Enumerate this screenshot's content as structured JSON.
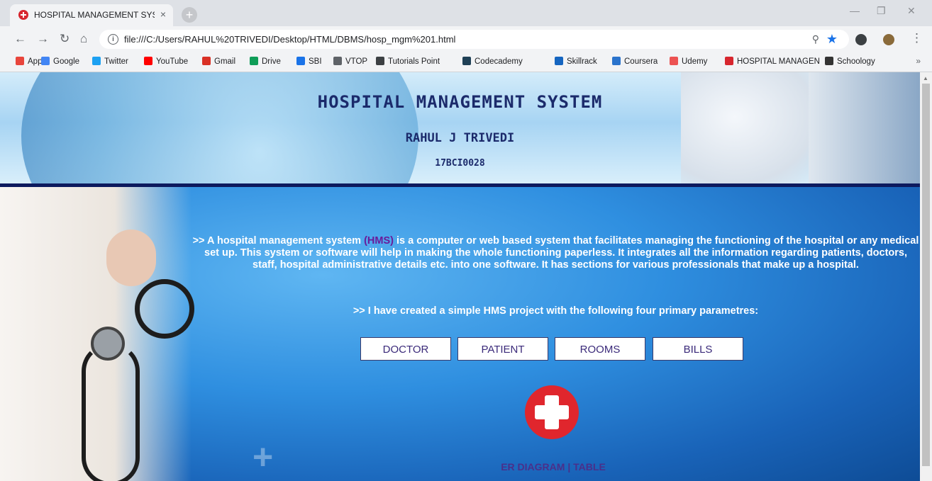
{
  "browser": {
    "tab_title": "HOSPITAL MANAGEMENT SYSTE",
    "tab_close": "×",
    "new_tab": "+",
    "url": "file:///C:/Users/RAHUL%20TRIVEDI/Desktop/HTML/DBMS/hosp_mgm%201.html",
    "bookmarks": [
      {
        "label": "Apps",
        "color": "#e8453c"
      },
      {
        "label": "Google",
        "color": "#4285f4"
      },
      {
        "label": "Twitter",
        "color": "#1da1f2"
      },
      {
        "label": "YouTube",
        "color": "#ff0000"
      },
      {
        "label": "Gmail",
        "color": "#d93025"
      },
      {
        "label": "Drive",
        "color": "#0f9d58"
      },
      {
        "label": "SBI",
        "color": "#1a73e8"
      },
      {
        "label": "VTOP",
        "color": "#5f6368"
      },
      {
        "label": "Tutorials Point",
        "color": "#3c4043"
      },
      {
        "label": "Codecademy",
        "color": "#1f4056"
      },
      {
        "label": "Skillrack",
        "color": "#1565c0"
      },
      {
        "label": "Coursera",
        "color": "#2a73cc"
      },
      {
        "label": "Udemy",
        "color": "#ec5252"
      },
      {
        "label": "HOSPITAL MANAGEN",
        "color": "#d7262e"
      },
      {
        "label": "Schoology",
        "color": "#333333"
      }
    ],
    "bookmarks_more": "»"
  },
  "header": {
    "title": "HOSPITAL MANAGEMENT SYSTEM",
    "name": "RAHUL J TRIVEDI",
    "id": "17BCI0028"
  },
  "intro": {
    "prefix": ">> A hospital management system ",
    "hms": "(HMS)",
    "body": " is a computer or web based system that facilitates managing the functioning of the hospital or any medical set up. This system or software will help in making the whole functioning paperless. It integrates all the information regarding patients, doctors, staff, hospital administrative details etc. into one software. It has sections for various professionals that make up a hospital.",
    "line2": ">> I have created a simple HMS project with the following four primary parametres:"
  },
  "nav_buttons": {
    "doctor": "DOCTOR",
    "patient": "PATIENT",
    "rooms": "ROOMS",
    "bills": "BILLS"
  },
  "footer_links": {
    "er": "ER DIAGRAM",
    "sep": " | ",
    "table": "TABLE"
  }
}
